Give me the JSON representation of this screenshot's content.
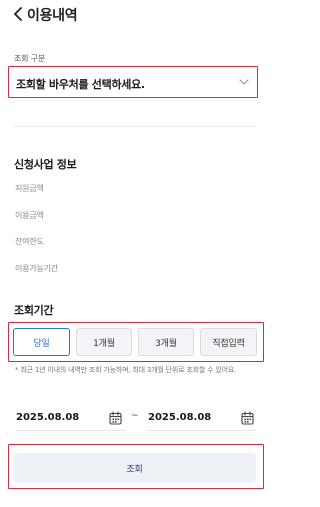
{
  "header": {
    "title": "이용내역"
  },
  "voucher": {
    "label": "조회 구분",
    "placeholder": "조회할 바우처를 선택하세요."
  },
  "info_section": {
    "title": "신청사업 정보",
    "items": [
      "지원금액",
      "이용금액",
      "잔여한도",
      "이용가능기간"
    ]
  },
  "period_section": {
    "title": "조회기간",
    "options": [
      "당일",
      "1개월",
      "3개월",
      "직접입력"
    ],
    "selected": "당일",
    "notice": "* 최근 1년 이내의 내역만 조회 가능하며, 최대 3개월 단위로 조회할 수 있어요."
  },
  "dates": {
    "start": "2025.08.08",
    "separator": "~",
    "end": "2025.08.08"
  },
  "actions": {
    "query_label": "조회"
  },
  "colors": {
    "accent_blue": "#2f6fe0",
    "highlight_red": "#e0283a",
    "button_bg": "#eef1f5"
  }
}
